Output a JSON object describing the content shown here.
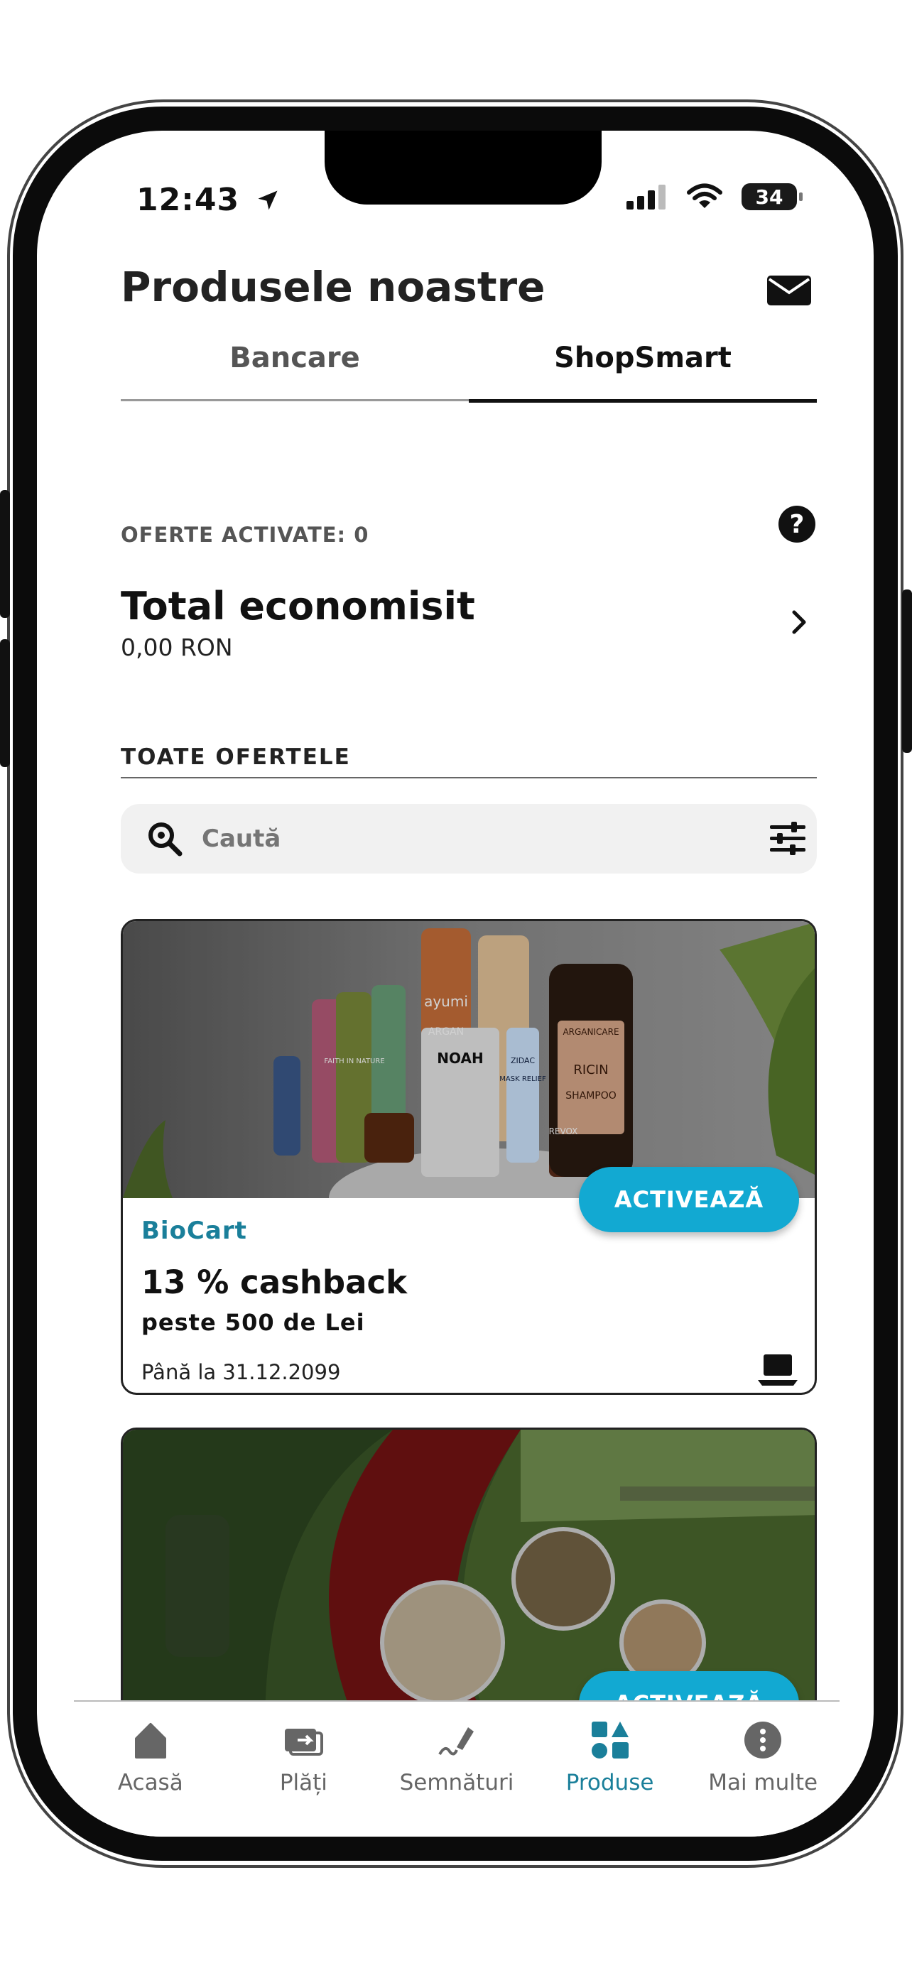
{
  "status": {
    "time": "12:43",
    "battery": "34"
  },
  "header": {
    "title": "Produsele noastre"
  },
  "tabs": [
    {
      "label": "Bancare"
    },
    {
      "label": "ShopSmart"
    }
  ],
  "summary": {
    "activated_label": "OFERTE ACTIVATE: 0",
    "total_title": "Total economisit",
    "total_value": "0,00 RON"
  },
  "offers_section": {
    "title": "TOATE OFERTELE"
  },
  "search": {
    "placeholder": "Caută"
  },
  "offers": [
    {
      "merchant": "BioCart",
      "cashback": "13 % cashback",
      "threshold": "peste 500 de Lei",
      "valid_until": "Până la 31.12.2099",
      "button": "ACTIVEAZĂ",
      "product_labels": [
        "ayumi",
        "ARGAN",
        "NOAH",
        "FAITH IN NATURE",
        "REVOX",
        "ARGANICARE",
        "RICIN",
        "SHAMPOO",
        "ZIDAC",
        "MASK RELIEF"
      ]
    },
    {
      "button": "ACTIVEAZĂ"
    }
  ],
  "nav": [
    {
      "label": "Acasă",
      "icon": "home-icon"
    },
    {
      "label": "Plăți",
      "icon": "payments-icon"
    },
    {
      "label": "Semnături",
      "icon": "signature-icon"
    },
    {
      "label": "Produse",
      "icon": "products-icon"
    },
    {
      "label": "Mai multe",
      "icon": "more-icon"
    }
  ],
  "colors": {
    "accent": "#12a9d2",
    "merchant": "#1a7f9a",
    "primary_text": "#111111"
  }
}
